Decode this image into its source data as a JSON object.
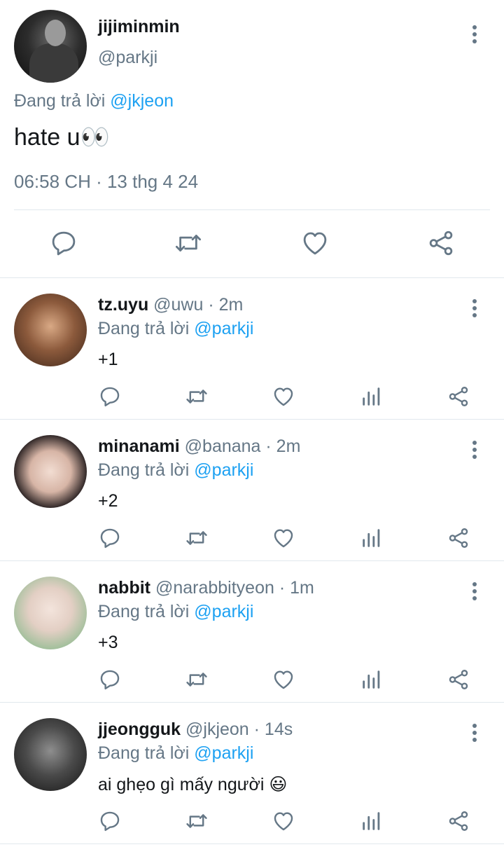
{
  "main_tweet": {
    "display_name": "jijiminmin",
    "handle": "@parkji",
    "replying_prefix": "Đang trả lời",
    "replying_to": "@jkjeon",
    "text": "hate u👀",
    "timestamp": "06:58 CH · 13 thg 4 24",
    "actions": [
      "reply-icon",
      "retweet-icon",
      "like-icon",
      "share-icon"
    ]
  },
  "replies": [
    {
      "display_name": "tz.uyu",
      "meta": "@uwu · 2m",
      "replying_prefix": "Đang trả lời",
      "replying_to": "@parkji",
      "text": "+1"
    },
    {
      "display_name": "minanami",
      "meta": "@banana · 2m",
      "replying_prefix": "Đang trả lời",
      "replying_to": "@parkji",
      "text": "+2"
    },
    {
      "display_name": "nabbit",
      "meta": "@narabbityeon · 1m",
      "replying_prefix": "Đang trả lời",
      "replying_to": "@parkji",
      "text": "+3"
    },
    {
      "display_name": "jjeongguk",
      "meta": "@jkjeon · 14s",
      "replying_prefix": "Đang trả lời",
      "replying_to": "@parkji",
      "text": "ai ghẹo gì mấy người 😃"
    }
  ],
  "colors": {
    "mention": "#1da1f2",
    "secondary": "#657786",
    "primary_text": "#14171a",
    "divider": "#e1e8ed"
  }
}
